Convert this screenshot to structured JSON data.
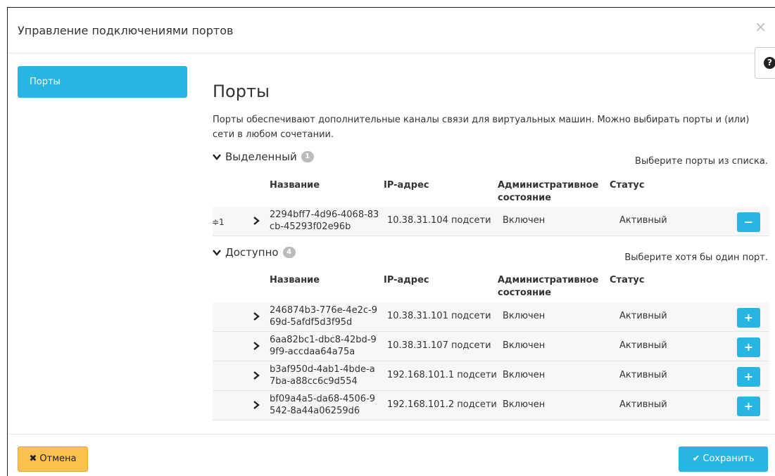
{
  "modal": {
    "title": "Управление подключениями портов",
    "close_icon": "×",
    "help_icon": "?"
  },
  "sidebar": {
    "items": [
      {
        "label": "Порты",
        "active": true
      }
    ]
  },
  "main": {
    "title": "Порты",
    "description": "Порты обеспечивают дополнительные каналы связи для виртуальных машин. Можно выбирать порты и (или) сети в любом сочетании."
  },
  "columns": {
    "name": "Название",
    "ip": "IP-адрес",
    "admin_line1": "Административное",
    "admin_line2": "состояние",
    "status": "Статус"
  },
  "allocated": {
    "label": "Выделенный",
    "count": "1",
    "hint": "Выберите порты из списка.",
    "rows": [
      {
        "order": "≑1",
        "name_line1": "2294bff7-4d96-4068-83",
        "name_line2": "cb-45293f02e96b",
        "ip": "10.38.31.104 подсети",
        "admin": "Включен",
        "status": "Активный",
        "action": "−"
      }
    ]
  },
  "available": {
    "label": "Доступно",
    "count": "4",
    "hint": "Выберите хотя бы один порт.",
    "rows": [
      {
        "name_line1": "246874b3-776e-4e2c-9",
        "name_line2": "69d-5afdf5d3f95d",
        "ip": "10.38.31.101 подсети",
        "admin": "Включен",
        "status": "Активный",
        "action": "+"
      },
      {
        "name_line1": "6aa82bc1-dbc8-42bd-9",
        "name_line2": "9f9-accdaa64a75a",
        "ip": "10.38.31.107 подсети",
        "admin": "Включен",
        "status": "Активный",
        "action": "+"
      },
      {
        "name_line1": "b3af950d-4ab1-4bde-a",
        "name_line2": "7ba-a88cc6c9d554",
        "ip": "192.168.101.1 подсети",
        "admin": "Включен",
        "status": "Активный",
        "action": "+"
      },
      {
        "name_line1": "bf09a4a5-da68-4506-9",
        "name_line2": "542-8a44a06259d6",
        "ip": "192.168.101.2 подсети",
        "admin": "Включен",
        "status": "Активный",
        "action": "+"
      }
    ]
  },
  "footer": {
    "cancel_icon": "✖",
    "cancel_label": "Отмена",
    "save_icon": "✔",
    "save_label": "Сохранить"
  },
  "colors": {
    "accent": "#27b5e2",
    "cancel": "#fdc14f",
    "badge": "#bbbbbb"
  }
}
